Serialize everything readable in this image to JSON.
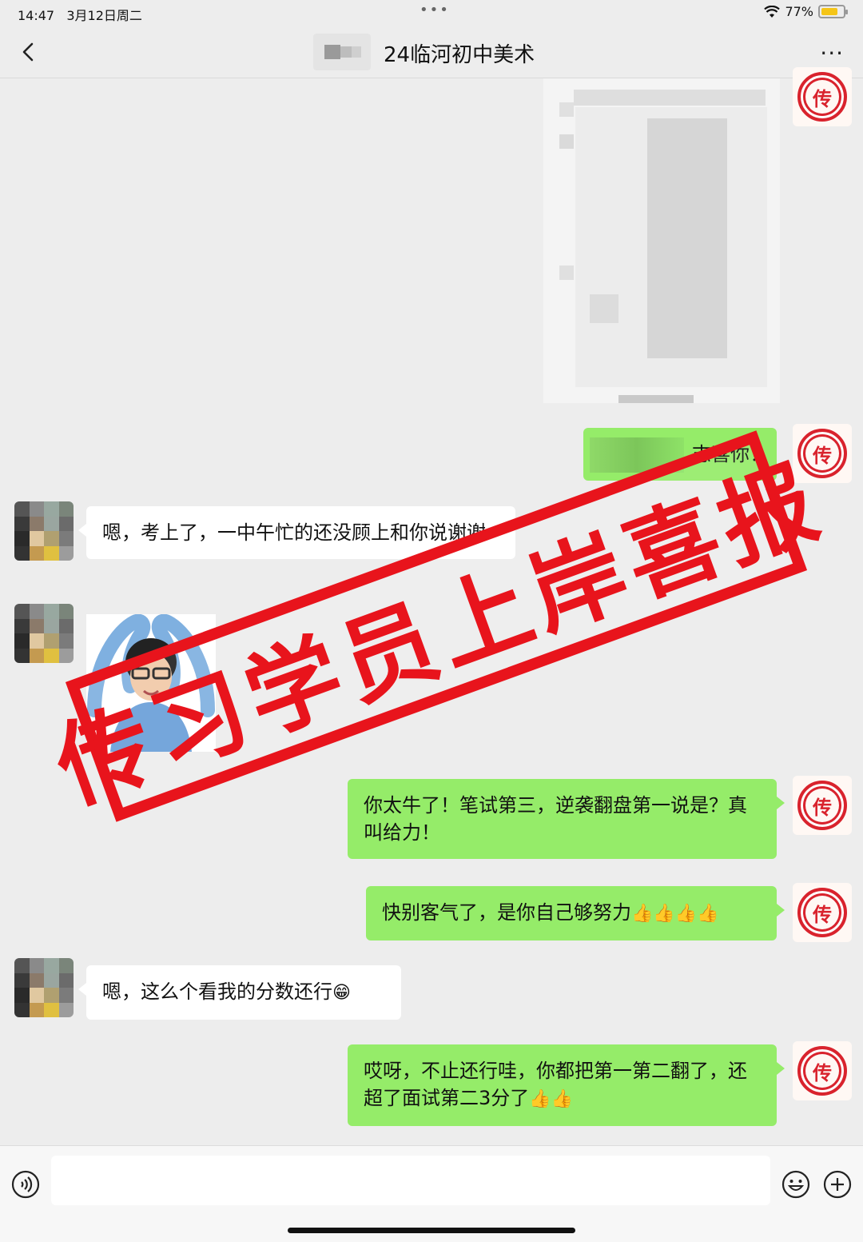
{
  "status_bar": {
    "time": "14:47",
    "date": "3月12日周二",
    "battery": "77%",
    "battery_level": 0.77,
    "dots": "•••"
  },
  "header": {
    "title": "24临河初中美术",
    "more": "···"
  },
  "messages": [
    {
      "side": "me",
      "type": "image",
      "blurred": true
    },
    {
      "side": "me",
      "type": "text",
      "text": "志喜你！",
      "partially_blurred": true
    },
    {
      "side": "other",
      "type": "text",
      "text": "嗯，考上了，一中午忙的还没顾上和你说谢谢"
    },
    {
      "side": "other",
      "type": "sticker",
      "sticker_icon": "heart-pose-sticker"
    },
    {
      "side": "me",
      "type": "text",
      "text": "你太牛了！笔试第三，逆袭翻盘第一说是？真叫给力！"
    },
    {
      "side": "me",
      "type": "text",
      "text": "快别客气了，是你自己够努力",
      "emoji": "👍👍👍👍"
    },
    {
      "side": "other",
      "type": "text",
      "text": "嗯，这么个看我的分数还行",
      "emoji": "😁"
    },
    {
      "side": "me",
      "type": "text",
      "text": "哎呀，不止还行哇，你都把第一第二翻了，还超了面试第二3分了",
      "emoji": "👍👍"
    }
  ],
  "stamp": {
    "text": "传习学员上岸喜报",
    "color": "#e8141c"
  },
  "seal_avatar": {
    "glyph": "传"
  },
  "input_bar": {
    "placeholder": "",
    "voice_icon": "voice-icon",
    "emoji_icon": "emoji-icon",
    "plus_icon": "plus-icon"
  },
  "colors": {
    "me_bubble": "#95ec69",
    "other_bubble": "#ffffff",
    "background": "#ededed"
  }
}
